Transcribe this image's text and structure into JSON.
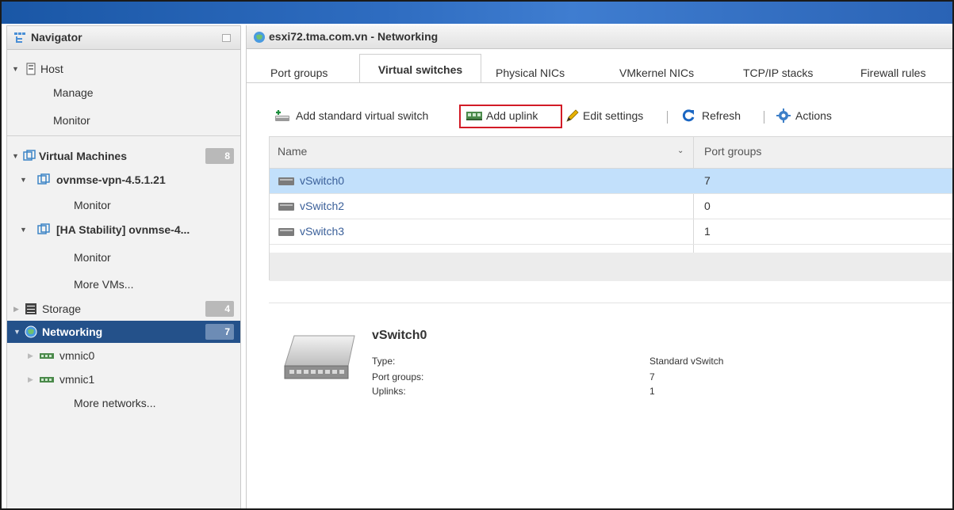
{
  "navigator": {
    "title": "Navigator",
    "host": {
      "label": "Host",
      "children": [
        "Manage",
        "Monitor"
      ]
    },
    "virtual_machines": {
      "label": "Virtual Machines",
      "count": "8",
      "vms": [
        {
          "label": "ovnmse-vpn-4.5.1.21",
          "child": "Monitor"
        },
        {
          "label": "[HA Stability] ovnmse-4...",
          "child": "Monitor"
        }
      ],
      "more": "More VMs..."
    },
    "storage": {
      "label": "Storage",
      "count": "4"
    },
    "networking": {
      "label": "Networking",
      "count": "7",
      "children": [
        "vmnic0",
        "vmnic1"
      ],
      "more": "More networks..."
    }
  },
  "main": {
    "title": "esxi72.tma.com.vn - Networking",
    "tabs": [
      "Port groups",
      "Virtual switches",
      "Physical NICs",
      "VMkernel NICs",
      "TCP/IP stacks",
      "Firewall rules"
    ],
    "active_tab": "Virtual switches",
    "toolbar": {
      "add_switch": "Add standard virtual switch",
      "add_uplink": "Add uplink",
      "edit_settings": "Edit settings",
      "refresh": "Refresh",
      "actions": "Actions"
    },
    "table": {
      "columns": [
        "Name",
        "Port groups"
      ],
      "rows": [
        {
          "name": "vSwitch0",
          "port_groups": "7",
          "selected": true
        },
        {
          "name": "vSwitch2",
          "port_groups": "0",
          "selected": false
        },
        {
          "name": "vSwitch3",
          "port_groups": "1",
          "selected": false
        }
      ]
    },
    "details": {
      "title": "vSwitch0",
      "type_label": "Type:",
      "type_value": "Standard vSwitch",
      "port_groups_label": "Port groups:",
      "port_groups_value": "7",
      "uplinks_label": "Uplinks:",
      "uplinks_value": "1"
    }
  },
  "colors": {
    "selected_nav": "#24518a",
    "selected_row": "#c2e0fb",
    "highlight_border": "#d21b26",
    "link": "#3a5f99"
  }
}
